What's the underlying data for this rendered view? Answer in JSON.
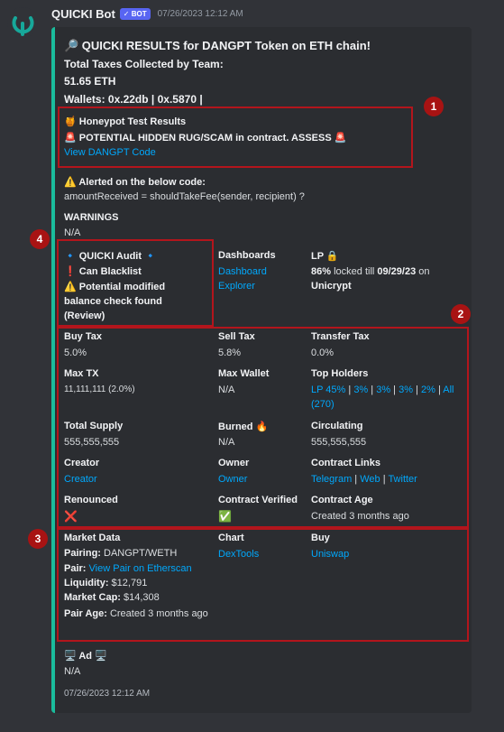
{
  "message": {
    "username": "QUICKI Bot",
    "bot_tag": "✓ BOT",
    "timestamp": "07/26/2023 12:12 AM"
  },
  "accent_color": "#1abc9c",
  "embed": {
    "title": "🔎 QUICKI RESULTS for DANGPT Token on ETH chain!",
    "taxes_label": "Total Taxes Collected by Team:",
    "taxes_value": "51.65 ETH",
    "wallets": "Wallets: 0x.22db | 0x.5870 |",
    "honeypot_title": "🍯 Honeypot Test Results",
    "honeypot_warning": "🚨 POTENTIAL HIDDEN RUG/SCAM in contract. ASSESS 🚨",
    "honeypot_link": "View DANGPT Code",
    "alert_title": "⚠️ Alerted on the below code:",
    "alert_code": "amountReceived = shouldTakeFee(sender, recipient) ?",
    "warnings_label": "WARNINGS",
    "warnings_value": "N/A",
    "audit": {
      "title": "🔹 QUICKI Audit 🔹",
      "line1": "❗ Can Blacklist",
      "line2": "⚠️ Potential modified balance check found (Review)"
    },
    "dashboards": {
      "label": "Dashboards",
      "link1": "Dashboard",
      "link2": "Explorer"
    },
    "lp": {
      "label": "LP 🔒",
      "percent": "86%",
      "locked_text": " locked till ",
      "date": "09/29/23",
      "on_text": " on",
      "platform": "Unicrypt"
    },
    "buy_tax": {
      "label": "Buy Tax",
      "value": "5.0%"
    },
    "sell_tax": {
      "label": "Sell Tax",
      "value": "5.8%"
    },
    "transfer_tax": {
      "label": "Transfer Tax",
      "value": "0.0%"
    },
    "max_tx": {
      "label": "Max TX",
      "value": "11,111,111 (2.0%)"
    },
    "max_wallet": {
      "label": "Max Wallet",
      "value": "N/A"
    },
    "top_holders": {
      "label": "Top Holders",
      "lp": "LP 45%",
      "h1": "3%",
      "h2": "3%",
      "h3": "3%",
      "h4": "2%",
      "all": "All",
      "all_count": "(270)",
      "sep": " | "
    },
    "total_supply": {
      "label": "Total Supply",
      "value": "555,555,555"
    },
    "burned": {
      "label": "Burned 🔥",
      "value": "N/A"
    },
    "circulating": {
      "label": "Circulating",
      "value": "555,555,555"
    },
    "creator": {
      "label": "Creator",
      "value": "Creator"
    },
    "owner": {
      "label": "Owner",
      "value": "Owner"
    },
    "contract_links": {
      "label": "Contract Links",
      "telegram": "Telegram",
      "web": "Web",
      "twitter": "Twitter",
      "sep": " | "
    },
    "renounced": {
      "label": "Renounced",
      "value": "❌"
    },
    "contract_verified": {
      "label": "Contract Verified",
      "value": "✅"
    },
    "contract_age": {
      "label": "Contract Age",
      "value": "Created 3 months ago"
    },
    "market_data": {
      "label": "Market Data",
      "pairing_label": "Pairing:",
      "pairing_value": " DANGPT/WETH",
      "pair_label": "Pair:",
      "pair_link": "View Pair on Etherscan",
      "liquidity_label": "Liquidity:",
      "liquidity_value": " $12,791",
      "mcap_label": "Market Cap:",
      "mcap_value": " $14,308",
      "age_label": "Pair Age:",
      "age_value": " Created 3 months ago"
    },
    "chart": {
      "label": "Chart",
      "link": "DexTools"
    },
    "buy": {
      "label": "Buy",
      "link": "Uniswap"
    },
    "ad": {
      "label": "🖥️ Ad 🖥️",
      "value": "N/A"
    },
    "footer": "07/26/2023 12:12 AM"
  },
  "annotations": [
    "1",
    "2",
    "3",
    "4"
  ]
}
